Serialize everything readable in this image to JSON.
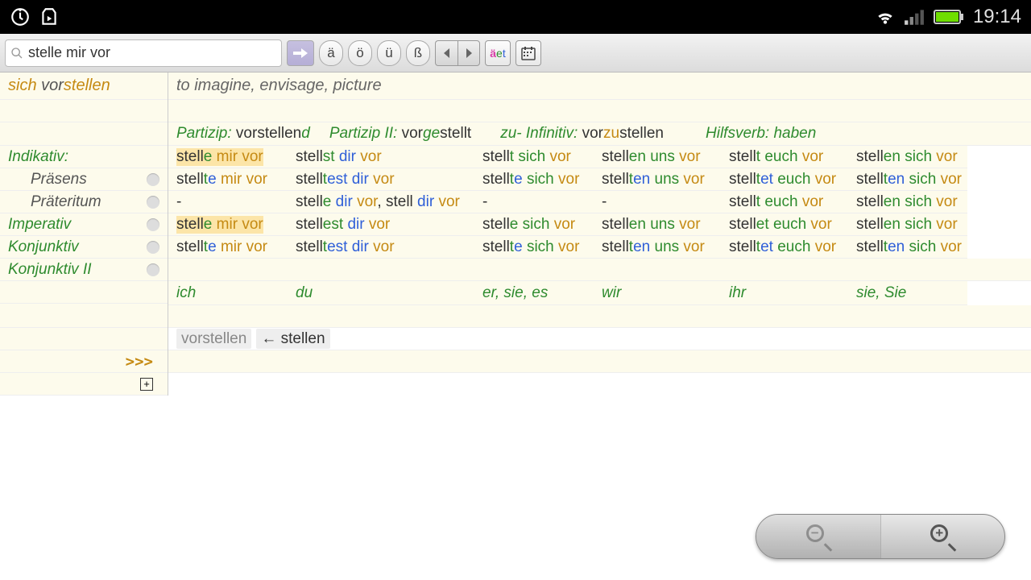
{
  "status": {
    "time": "19:14"
  },
  "toolbar": {
    "search_value": "stelle mir vor",
    "uml": {
      "a": "ä",
      "o": "ö",
      "u": "ü",
      "sz": "ß"
    },
    "color_btn": {
      "a": "ä",
      "e": "e",
      "t": "t"
    }
  },
  "sidebar": {
    "headword": {
      "sich": "sich ",
      "vor": "vor",
      "stem": "stellen"
    },
    "rows": [
      {
        "label": "Indikativ:",
        "indent": false,
        "dot": false
      },
      {
        "label": "Präsens",
        "indent": true,
        "dot": true
      },
      {
        "label": "Präteritum",
        "indent": true,
        "dot": true
      },
      {
        "label": "Imperativ",
        "indent": false,
        "dot": true
      },
      {
        "label": "Konjunktiv",
        "indent": false,
        "dot": true
      },
      {
        "label": "Konjunktiv II",
        "indent": false,
        "dot": true
      }
    ],
    "more": ">>>",
    "expand": "+"
  },
  "main": {
    "translation": "to imagine, envisage, picture",
    "forms": {
      "partizip_lbl": "Partizip:",
      "partizip_pre": "vor",
      "partizip_stem": "stellen",
      "partizip_suf": "d",
      "p2_lbl": "Partizip II:",
      "p2_pre": "vor",
      "p2_ge": "ge",
      "p2_stem": "stellt",
      "inf_lbl": "zu- Infinitiv:",
      "inf_pre": "vor",
      "inf_zu": "zu",
      "inf_stem": "stellen",
      "hilf_lbl": "Hilfsverb:",
      "hilf_val": "haben"
    },
    "pronouns": [
      "ich",
      "du",
      "er, sie, es",
      "wir",
      "ihr",
      "sie, Sie"
    ],
    "related": {
      "vorstellen": "vorstellen",
      "stellen": "← stellen"
    },
    "table": [
      [
        {
          "p": [
            "stell",
            "e",
            " ",
            "mir",
            " ",
            "vor"
          ],
          "c": [
            "",
            "g",
            "",
            "o",
            "",
            "o"
          ],
          "hi": true
        },
        {
          "p": [
            "stell",
            "st",
            " ",
            "dir",
            " ",
            "vor"
          ],
          "c": [
            "",
            "g",
            "",
            "b",
            "",
            "o"
          ]
        },
        {
          "p": [
            "stell",
            "t",
            " ",
            "sich",
            " ",
            "vor"
          ],
          "c": [
            "",
            "g",
            "",
            "g",
            "",
            "o"
          ]
        },
        {
          "p": [
            "stell",
            "en",
            " ",
            "uns",
            " ",
            "vor"
          ],
          "c": [
            "",
            "g",
            "",
            "g",
            "",
            "o"
          ]
        },
        {
          "p": [
            "stell",
            "t",
            " ",
            "euch",
            " ",
            "vor"
          ],
          "c": [
            "",
            "g",
            "",
            "g",
            "",
            "o"
          ]
        },
        {
          "p": [
            "stell",
            "en",
            " ",
            "sich",
            " ",
            "vor"
          ],
          "c": [
            "",
            "g",
            "",
            "g",
            "",
            "o"
          ]
        }
      ],
      [
        {
          "p": [
            "stell",
            "t",
            "e",
            " ",
            "mir",
            " ",
            "vor"
          ],
          "c": [
            "",
            "g",
            "b",
            "",
            "o",
            "",
            "o"
          ]
        },
        {
          "p": [
            "stell",
            "t",
            "est",
            " ",
            "dir",
            " ",
            "vor"
          ],
          "c": [
            "",
            "g",
            "b",
            "",
            "b",
            "",
            "o"
          ]
        },
        {
          "p": [
            "stell",
            "t",
            "e",
            " ",
            "sich",
            " ",
            "vor"
          ],
          "c": [
            "",
            "g",
            "b",
            "",
            "g",
            "",
            "o"
          ]
        },
        {
          "p": [
            "stell",
            "t",
            "en",
            " ",
            "uns",
            " ",
            "vor"
          ],
          "c": [
            "",
            "g",
            "b",
            "",
            "g",
            "",
            "o"
          ]
        },
        {
          "p": [
            "stell",
            "t",
            "et",
            " ",
            "euch",
            " ",
            "vor"
          ],
          "c": [
            "",
            "g",
            "b",
            "",
            "g",
            "",
            "o"
          ]
        },
        {
          "p": [
            "stell",
            "t",
            "en",
            " ",
            "sich",
            " ",
            "vor"
          ],
          "c": [
            "",
            "g",
            "b",
            "",
            "g",
            "",
            "o"
          ]
        }
      ],
      [
        {
          "p": [
            "-"
          ],
          "c": [
            ""
          ]
        },
        {
          "p": [
            "stell",
            "e",
            " ",
            "dir",
            " ",
            "vor",
            ", stell ",
            "dir",
            " ",
            "vor"
          ],
          "c": [
            "",
            "g",
            "",
            "b",
            "",
            "o",
            "",
            "b",
            "",
            "o"
          ]
        },
        {
          "p": [
            "-"
          ],
          "c": [
            ""
          ]
        },
        {
          "p": [
            "-"
          ],
          "c": [
            ""
          ]
        },
        {
          "p": [
            "stell",
            "t",
            " ",
            "euch",
            " ",
            "vor"
          ],
          "c": [
            "",
            "g",
            "",
            "g",
            "",
            "o"
          ]
        },
        {
          "p": [
            "stell",
            "en",
            " ",
            "sich",
            " ",
            "vor"
          ],
          "c": [
            "",
            "g",
            "",
            "g",
            "",
            "o"
          ]
        }
      ],
      [
        {
          "p": [
            "stell",
            "e",
            " ",
            "mir",
            " ",
            "vor"
          ],
          "c": [
            "",
            "g",
            "",
            "o",
            "",
            "o"
          ],
          "hi": true
        },
        {
          "p": [
            "stell",
            "est",
            " ",
            "dir",
            " ",
            "vor"
          ],
          "c": [
            "",
            "g",
            "",
            "b",
            "",
            "o"
          ]
        },
        {
          "p": [
            "stell",
            "e",
            " ",
            "sich",
            " ",
            "vor"
          ],
          "c": [
            "",
            "g",
            "",
            "g",
            "",
            "o"
          ]
        },
        {
          "p": [
            "stell",
            "en",
            " ",
            "uns",
            " ",
            "vor"
          ],
          "c": [
            "",
            "g",
            "",
            "g",
            "",
            "o"
          ]
        },
        {
          "p": [
            "stell",
            "et",
            " ",
            "euch",
            " ",
            "vor"
          ],
          "c": [
            "",
            "g",
            "",
            "g",
            "",
            "o"
          ]
        },
        {
          "p": [
            "stell",
            "en",
            " ",
            "sich",
            " ",
            "vor"
          ],
          "c": [
            "",
            "g",
            "",
            "g",
            "",
            "o"
          ]
        }
      ],
      [
        {
          "p": [
            "stell",
            "t",
            "e",
            " ",
            "mir",
            " ",
            "vor"
          ],
          "c": [
            "",
            "g",
            "b",
            "",
            "o",
            "",
            "o"
          ]
        },
        {
          "p": [
            "stell",
            "t",
            "est",
            " ",
            "dir",
            " ",
            "vor"
          ],
          "c": [
            "",
            "g",
            "b",
            "",
            "b",
            "",
            "o"
          ]
        },
        {
          "p": [
            "stell",
            "t",
            "e",
            " ",
            "sich",
            " ",
            "vor"
          ],
          "c": [
            "",
            "g",
            "b",
            "",
            "g",
            "",
            "o"
          ]
        },
        {
          "p": [
            "stell",
            "t",
            "en",
            " ",
            "uns",
            " ",
            "vor"
          ],
          "c": [
            "",
            "g",
            "b",
            "",
            "g",
            "",
            "o"
          ]
        },
        {
          "p": [
            "stell",
            "t",
            "et",
            " ",
            "euch",
            " ",
            "vor"
          ],
          "c": [
            "",
            "g",
            "b",
            "",
            "g",
            "",
            "o"
          ]
        },
        {
          "p": [
            "stell",
            "t",
            "en",
            " ",
            "sich",
            " ",
            "vor"
          ],
          "c": [
            "",
            "g",
            "b",
            "",
            "g",
            "",
            "o"
          ]
        }
      ]
    ]
  }
}
